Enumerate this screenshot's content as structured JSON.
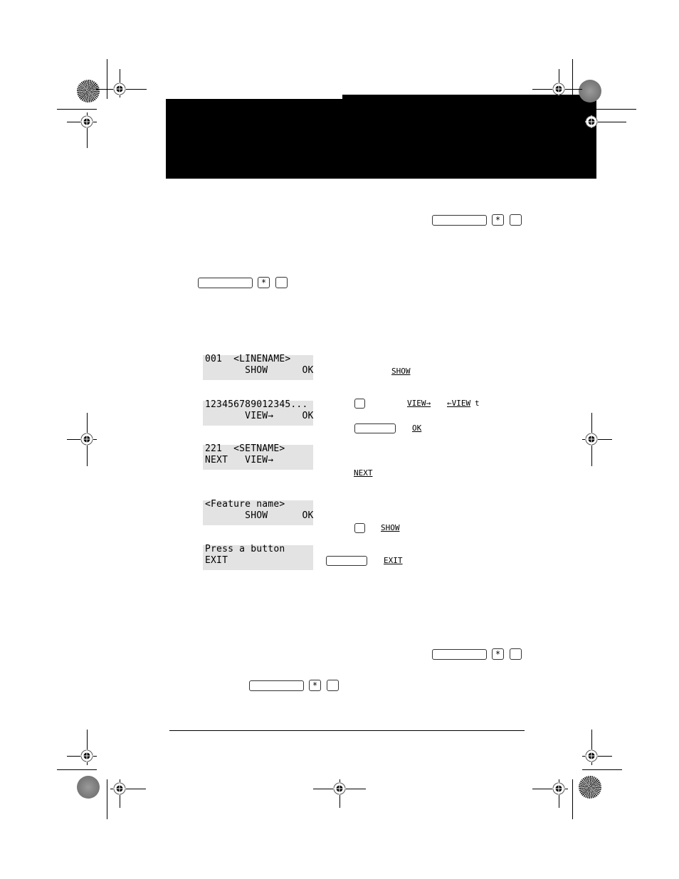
{
  "page": {
    "header_bar": "black chapter header band (no visible text)",
    "colors": {
      "ink": "#000000",
      "lcd_background": "#e3e3e3",
      "page": "#ffffff"
    }
  },
  "keys": {
    "star_label": "*"
  },
  "lcd_displays": [
    {
      "line1": "001  <LINENAME>",
      "line2": "       SHOW      OK"
    },
    {
      "line1": "123456789012345...",
      "line2": "       VIEW→     OK"
    },
    {
      "line1": "221  <SETNAME>",
      "line2": "NEXT   VIEW→"
    },
    {
      "line1": "<Feature name>",
      "line2": "       SHOW      OK"
    },
    {
      "line1": "Press a button",
      "line2": "EXIT"
    }
  ],
  "instructions": {
    "show_1": "SHOW",
    "view_right": "VIEW→",
    "view_left": "←VIEW",
    "view_left_suffix": "t",
    "ok": "OK",
    "next": "NEXT",
    "show_2": "SHOW",
    "exit": "EXIT"
  },
  "icons": {
    "registration_mark": "crosshair-target-icon",
    "color_bar_star": "star-target-icon",
    "gray_disc": "halftone-disc-icon"
  }
}
